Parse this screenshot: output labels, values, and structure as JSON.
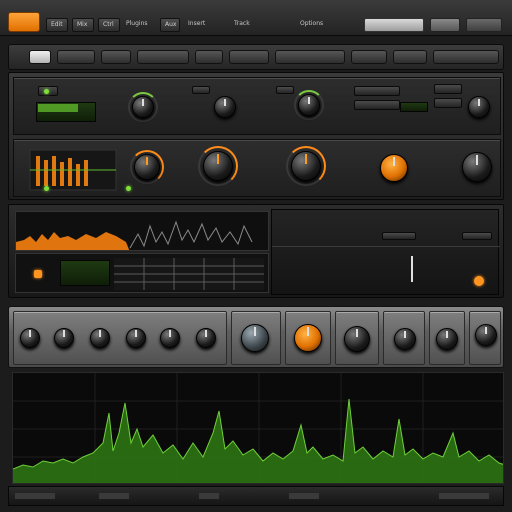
{
  "topbar": {
    "logo_text": "",
    "menu_items": [
      "Edit",
      "Mix",
      "Ctrl",
      "Plugins",
      "Aux",
      "Insert",
      "Track"
    ],
    "right_items": [
      "Options"
    ]
  },
  "toolbar": {
    "buttons": [
      "",
      "",
      "",
      "",
      "",
      "",
      "",
      "",
      "",
      ""
    ]
  },
  "rack1": {
    "lcd_text": "",
    "knob_labels_top": [
      "",
      "",
      "",
      "",
      ""
    ],
    "knob_labels_bottom": [
      "",
      "",
      "",
      "",
      "",
      ""
    ]
  },
  "rack2": {
    "header_labels": [
      "",
      "",
      ""
    ],
    "meter_text": ""
  },
  "rack3": {
    "knobs": 12
  },
  "footer": {
    "labels": []
  },
  "colors": {
    "accent_orange": "#ff8c1a",
    "meter_green": "#6fd13a",
    "background": "#1c1c1c"
  }
}
